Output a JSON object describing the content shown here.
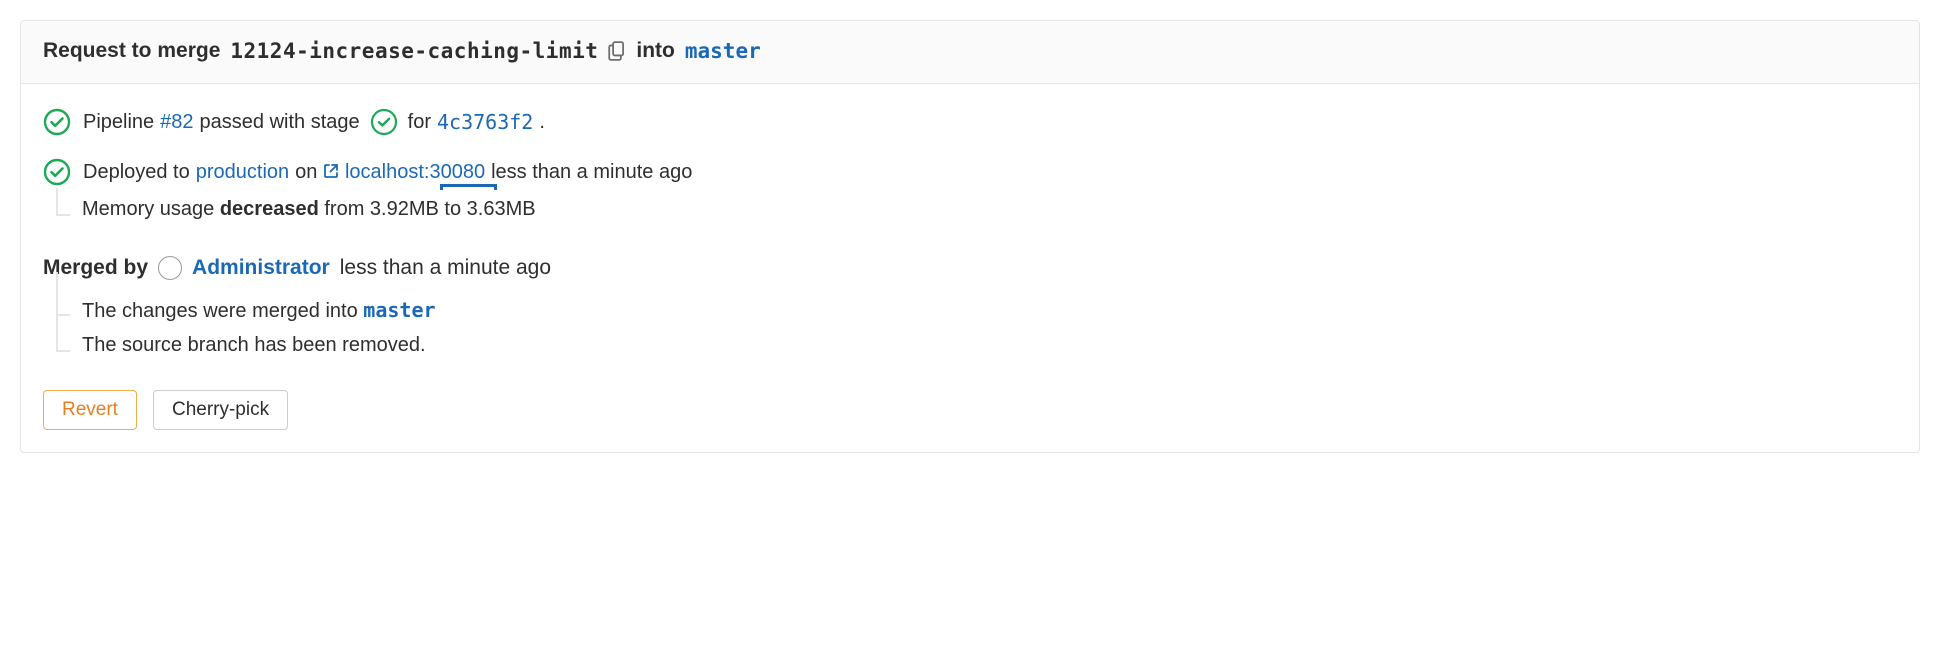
{
  "header": {
    "request_text": "Request to merge",
    "source_branch": "12124-increase-caching-limit",
    "into_text": "into",
    "target_branch": "master"
  },
  "pipeline": {
    "prefix": "Pipeline",
    "id_label": "#82",
    "mid1": "passed with stage",
    "mid2": "for",
    "commit": "4c3763f2",
    "suffix": "."
  },
  "deploy": {
    "prefix": "Deployed to",
    "env": "production",
    "on_text": "on",
    "host": "localhost:30080",
    "time": "less than a minute ago"
  },
  "memory": {
    "prefix": "Memory usage",
    "direction": "decreased",
    "rest": "from 3.92MB to 3.63MB"
  },
  "merged": {
    "by_label": "Merged by",
    "user": "Administrator",
    "time": "less than a minute ago",
    "line1_prefix": "The changes were merged into",
    "line1_branch": "master",
    "line2": "The source branch has been removed."
  },
  "buttons": {
    "revert": "Revert",
    "cherry": "Cherry-pick"
  }
}
